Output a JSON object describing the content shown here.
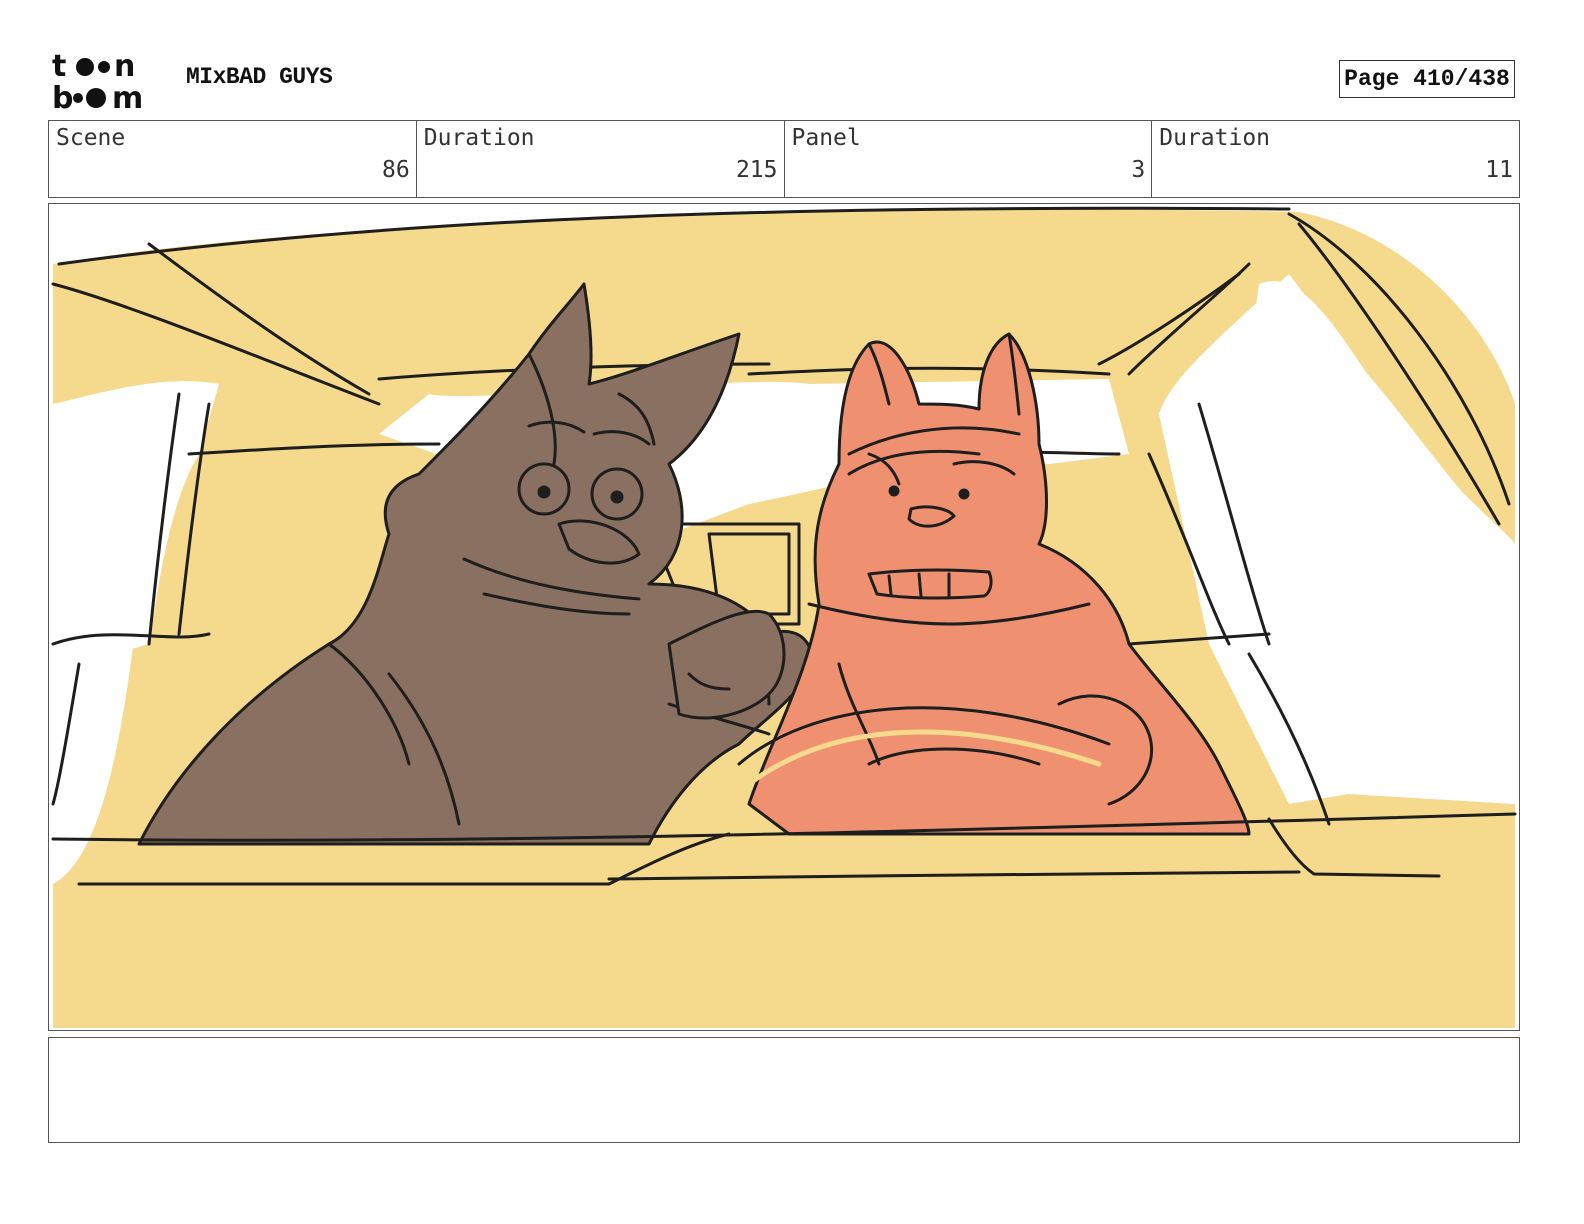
{
  "header": {
    "logo_line1": "t••n",
    "logo_line2": "b••m",
    "project_title": "MIxBAD GUYS",
    "page_indicator": "Page 410/438"
  },
  "info": {
    "scene_label": "Scene",
    "scene_value": "86",
    "scene_duration_label": "Duration",
    "scene_duration_value": "215",
    "panel_label": "Panel",
    "panel_value": "3",
    "panel_duration_label": "Duration",
    "panel_duration_value": "11"
  },
  "notes": {
    "text": ""
  },
  "colors": {
    "car_interior": "#f5d98d",
    "wolf": "#8a7060",
    "fox": "#ef9170",
    "line": "#1e1e1e"
  }
}
